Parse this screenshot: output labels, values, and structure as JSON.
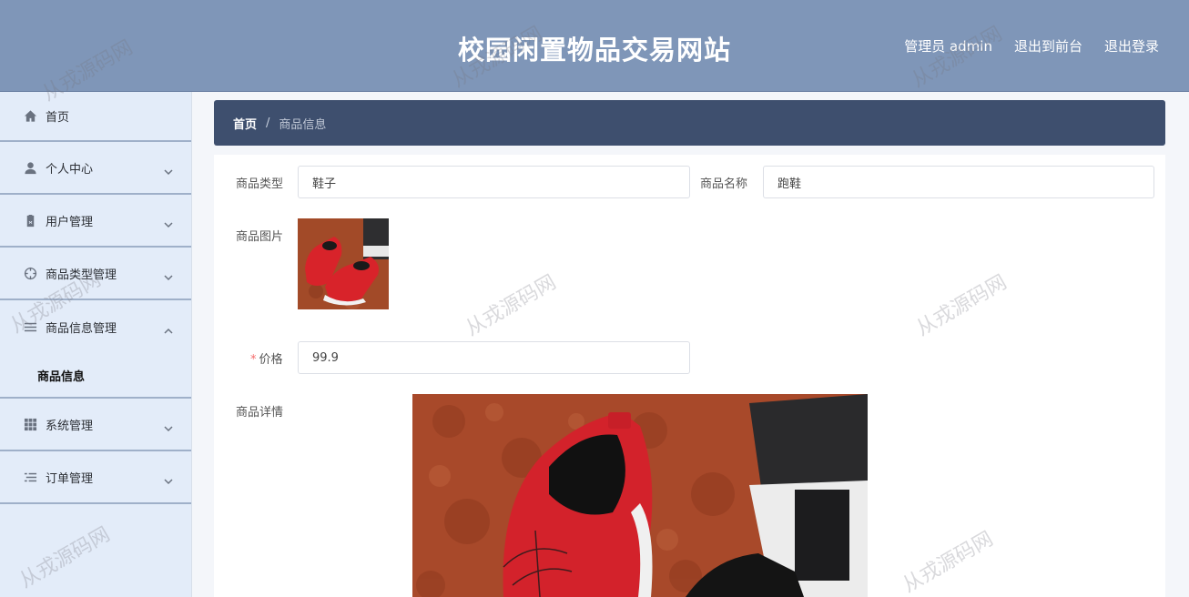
{
  "header": {
    "title": "校园闲置物品交易网站",
    "user_label": "管理员 admin",
    "front_label": "退出到前台",
    "logout_label": "退出登录"
  },
  "sidebar": {
    "items": [
      {
        "label": "首页",
        "icon": "home-icon"
      },
      {
        "label": "个人中心",
        "icon": "user-icon"
      },
      {
        "label": "用户管理",
        "icon": "clipboard-icon"
      },
      {
        "label": "商品类型管理",
        "icon": "compass-icon"
      },
      {
        "label": "商品信息管理",
        "icon": "list-icon"
      },
      {
        "label": "系统管理",
        "icon": "grid-icon"
      },
      {
        "label": "订单管理",
        "icon": "order-list-icon"
      }
    ],
    "subitem": "商品信息"
  },
  "breadcrumb": {
    "home": "首页",
    "separator": "/",
    "current": "商品信息"
  },
  "form": {
    "type_label": "商品类型",
    "type_value": "鞋子",
    "name_label": "商品名称",
    "name_value": "跑鞋",
    "image_label": "商品图片",
    "price_required": "*",
    "price_label": "价格",
    "price_value": "99.9",
    "detail_label": "商品详情"
  },
  "watermark": "从戎源码网"
}
